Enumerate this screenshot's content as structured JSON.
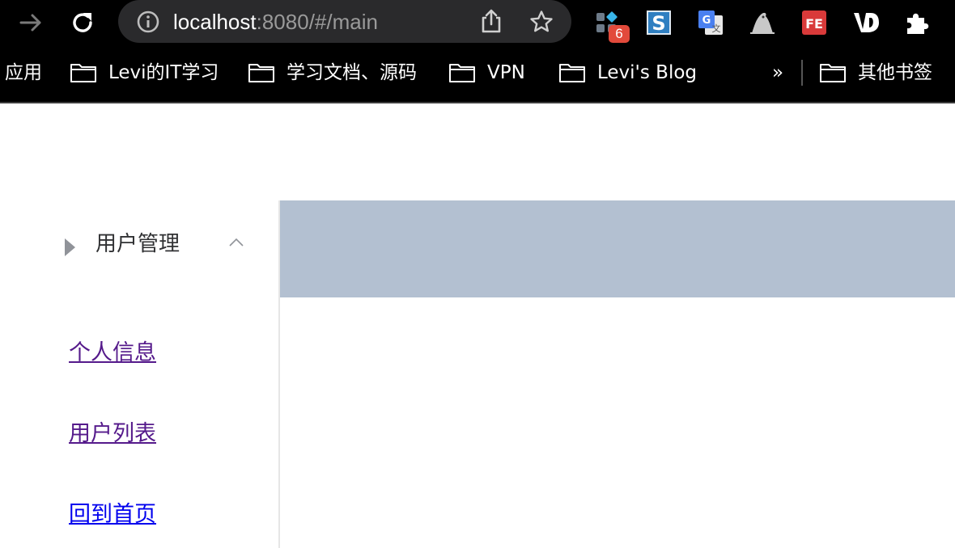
{
  "browser": {
    "address": {
      "host": "localhost",
      "rest": ":8080/#/main"
    },
    "extensions": [
      {
        "name": "grid-extension-icon",
        "badge": "6"
      },
      {
        "name": "s-extension-icon"
      },
      {
        "name": "google-translate-icon"
      },
      {
        "name": "seal-extension-icon"
      },
      {
        "name": "fe-extension-icon"
      },
      {
        "name": "vd-extension-icon"
      },
      {
        "name": "puzzle-extensions-icon"
      }
    ],
    "bookmarks": {
      "apps_label": "应用",
      "items": [
        "Levi的IT学习",
        "学习文档、源码",
        "VPN",
        "Levi's Blog"
      ],
      "overflow_label": "»",
      "other_label": "其他书签"
    }
  },
  "sidebar": {
    "submenu_title": "用户管理",
    "links": [
      "个人信息",
      "用户列表",
      "回到首页"
    ]
  },
  "colors": {
    "header_bg": "#b3c0d1",
    "visited_link": "#551a8b",
    "link": "#0000ee",
    "badge": "#e24a3b"
  }
}
